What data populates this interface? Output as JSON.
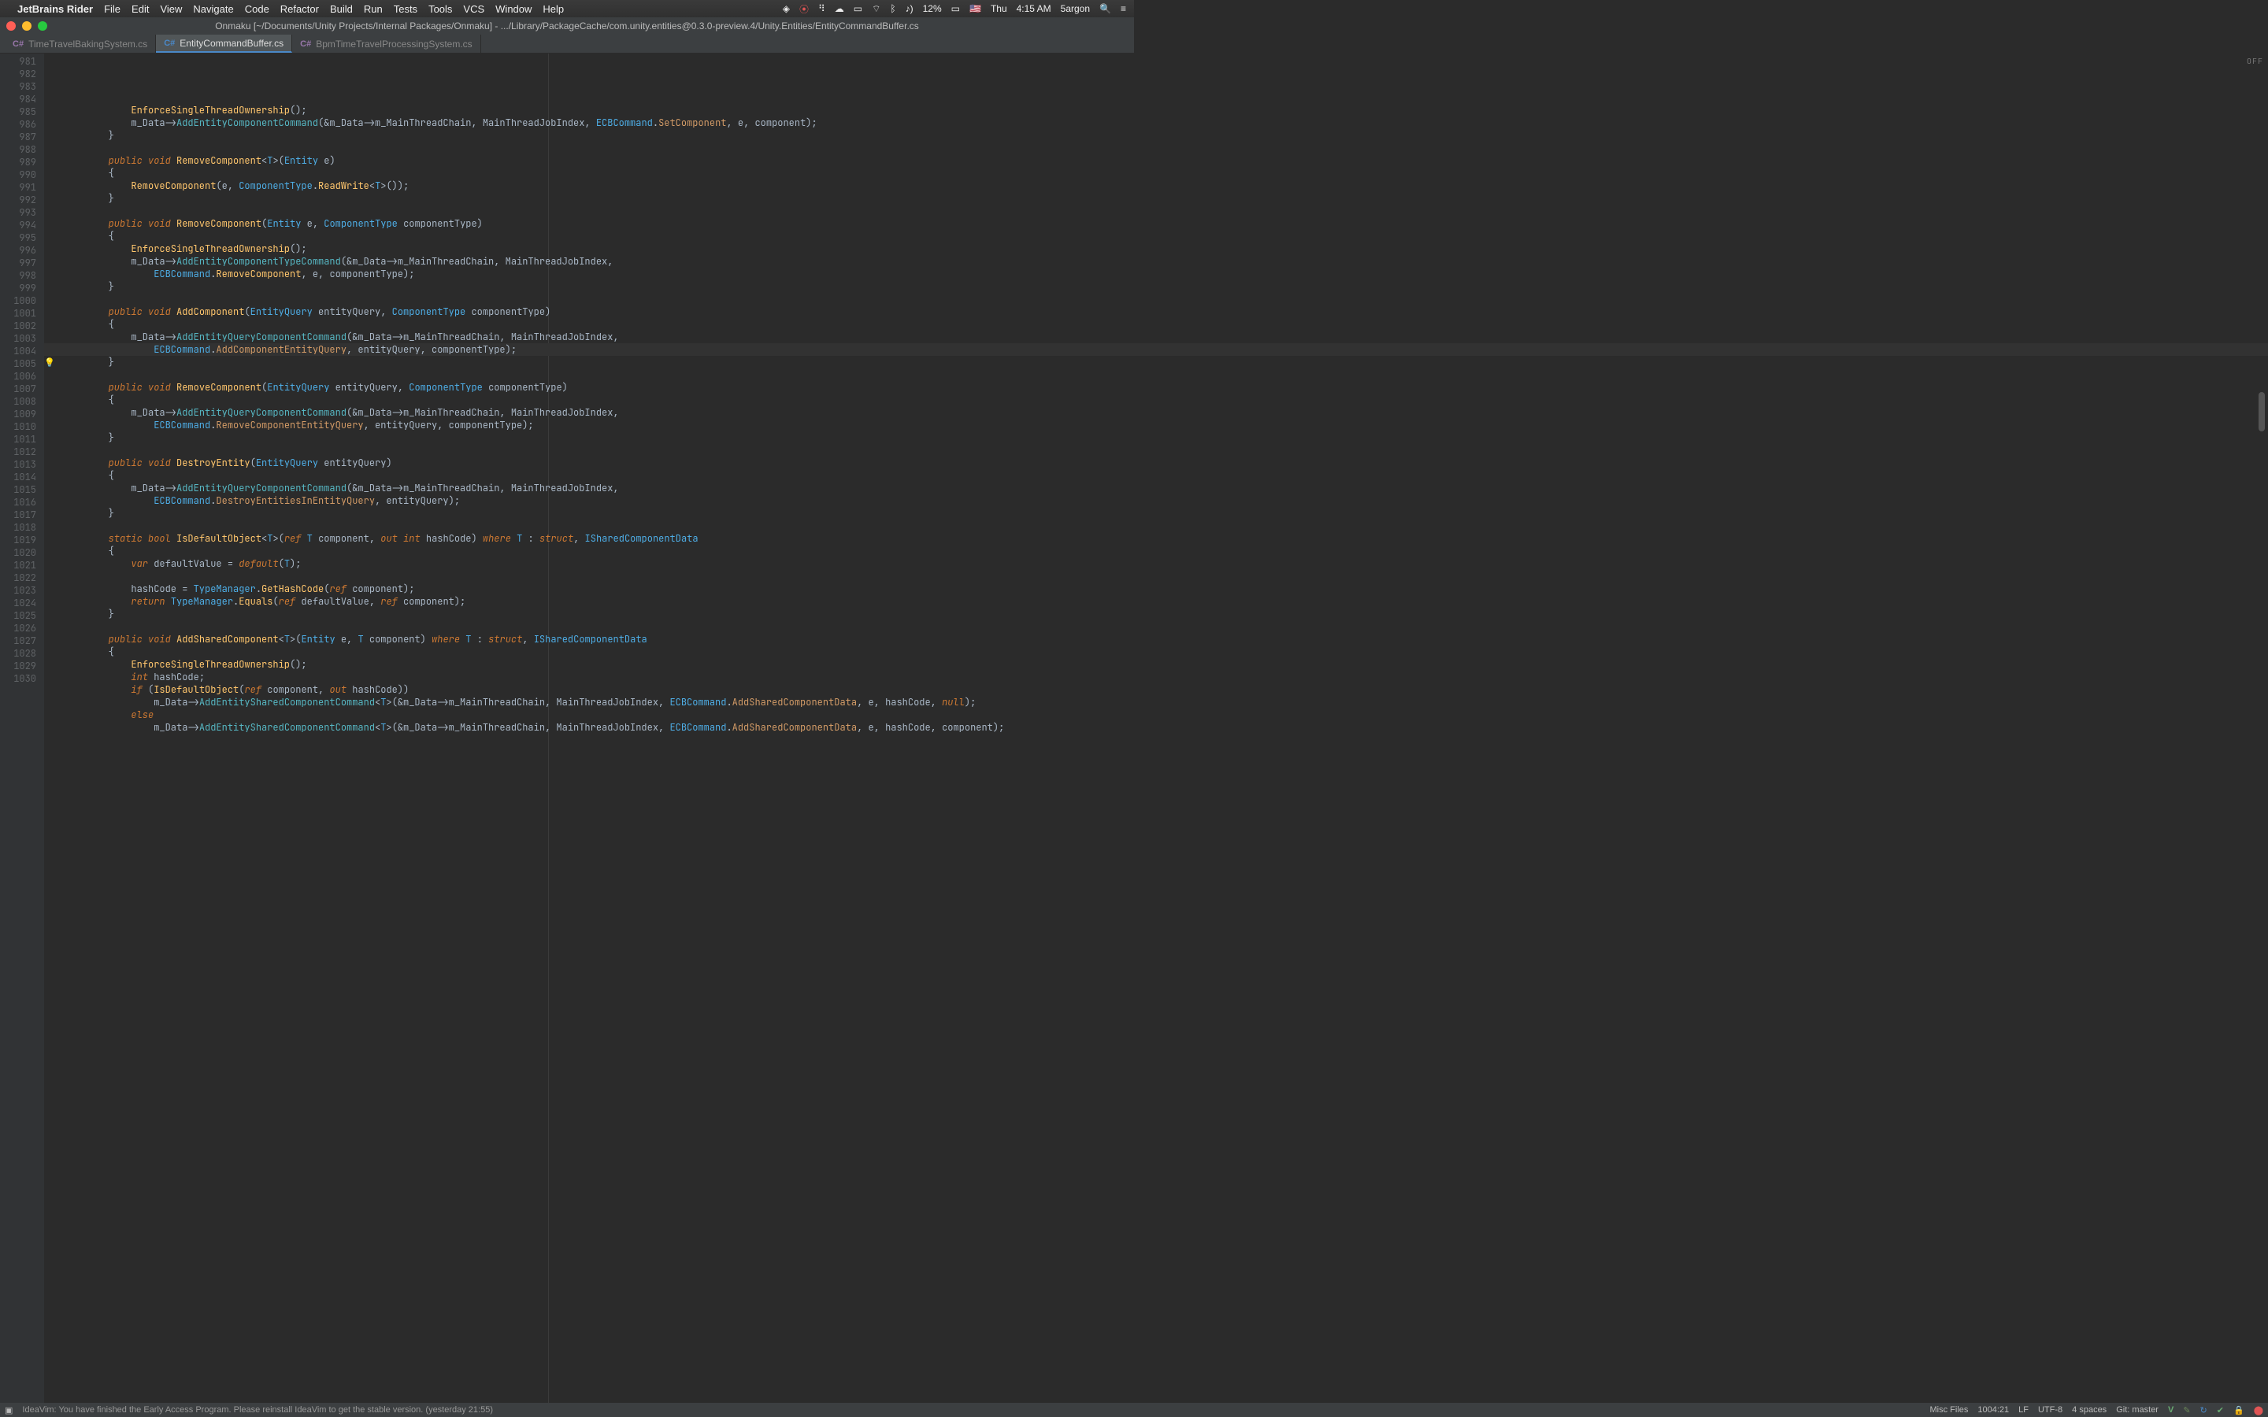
{
  "menubar": {
    "app": "JetBrains Rider",
    "items": [
      "File",
      "Edit",
      "View",
      "Navigate",
      "Code",
      "Refactor",
      "Build",
      "Run",
      "Tests",
      "Tools",
      "VCS",
      "Window",
      "Help"
    ],
    "right": {
      "battery": "12%",
      "flag": "🇺🇸",
      "day": "Thu",
      "time": "4:15 AM",
      "user": "5argon"
    }
  },
  "window": {
    "title": "Onmaku [~/Documents/Unity Projects/Internal Packages/Onmaku] - .../Library/PackageCache/com.unity.entities@0.3.0-preview.4/Unity.Entities/EntityCommandBuffer.cs"
  },
  "tabs": [
    {
      "icon": "C#",
      "label": "TimeTravelBakingSystem.cs",
      "active": false
    },
    {
      "icon": "C#",
      "label": "EntityCommandBuffer.cs",
      "active": true
    },
    {
      "icon": "C#",
      "label": "BpmTimeTravelProcessingSystem.cs",
      "active": false
    }
  ],
  "editor": {
    "off": "OFF",
    "first_line": 981,
    "highlight_line": 1004,
    "bulb_line": 1005,
    "lines": [
      "            EnforceSingleThreadOwnership();",
      "            m_Data->AddEntityComponentCommand(&m_Data->m_MainThreadChain, MainThreadJobIndex, ECBCommand.SetComponent, e, component);",
      "        }",
      "",
      "        public void RemoveComponent<T>(Entity e)",
      "        {",
      "            RemoveComponent(e, ComponentType.ReadWrite<T>());",
      "        }",
      "",
      "        public void RemoveComponent(Entity e, ComponentType componentType)",
      "        {",
      "            EnforceSingleThreadOwnership();",
      "            m_Data->AddEntityComponentTypeCommand(&m_Data->m_MainThreadChain, MainThreadJobIndex,",
      "                ECBCommand.RemoveComponent, e, componentType);",
      "        }",
      "",
      "        public void AddComponent(EntityQuery entityQuery, ComponentType componentType)",
      "        {",
      "            m_Data->AddEntityQueryComponentCommand(&m_Data->m_MainThreadChain, MainThreadJobIndex,",
      "                ECBCommand.AddComponentEntityQuery, entityQuery, componentType);",
      "        }",
      "",
      "        public void RemoveComponent(EntityQuery entityQuery, ComponentType componentType)",
      "        {",
      "            m_Data->AddEntityQueryComponentCommand(&m_Data->m_MainThreadChain, MainThreadJobIndex,",
      "                ECBCommand.RemoveComponentEntityQuery, entityQuery, componentType);",
      "        }",
      "",
      "        public void DestroyEntity(EntityQuery entityQuery)",
      "        {",
      "            m_Data->AddEntityQueryComponentCommand(&m_Data->m_MainThreadChain, MainThreadJobIndex,",
      "                ECBCommand.DestroyEntitiesInEntityQuery, entityQuery);",
      "        }",
      "",
      "        static bool IsDefaultObject<T>(ref T component, out int hashCode) where T : struct, ISharedComponentData",
      "        {",
      "            var defaultValue = default(T);",
      "",
      "            hashCode = TypeManager.GetHashCode(ref component);",
      "            return TypeManager.Equals(ref defaultValue, ref component);",
      "        }",
      "",
      "        public void AddSharedComponent<T>(Entity e, T component) where T : struct, ISharedComponentData",
      "        {",
      "            EnforceSingleThreadOwnership();",
      "            int hashCode;",
      "            if (IsDefaultObject(ref component, out hashCode))",
      "                m_Data->AddEntitySharedComponentCommand<T>(&m_Data->m_MainThreadChain, MainThreadJobIndex, ECBCommand.AddSharedComponentData, e, hashCode, null);",
      "            else",
      "                m_Data->AddEntitySharedComponentCommand<T>(&m_Data->m_MainThreadChain, MainThreadJobIndex, ECBCommand.AddSharedComponentData, e, hashCode, component);"
    ]
  },
  "statusbar": {
    "message": "IdeaVim: You have finished the Early Access Program. Please reinstall IdeaVim to get the stable version. (yesterday 21:55)",
    "misc": "Misc Files",
    "pos": "1004:21",
    "le": "LF",
    "enc": "UTF-8",
    "indent": "4 spaces",
    "git": "Git: master"
  }
}
